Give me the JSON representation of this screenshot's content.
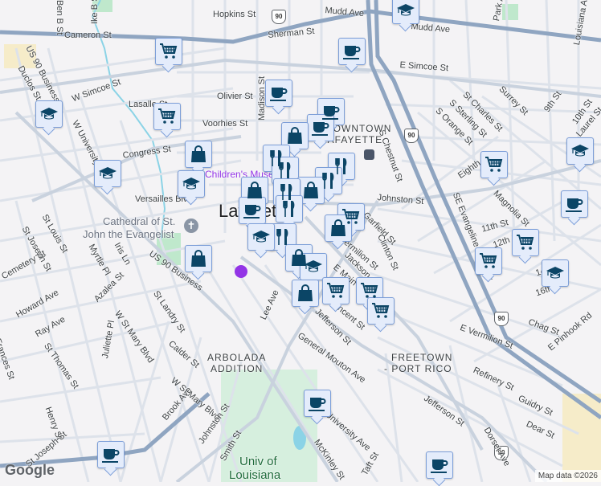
{
  "map": {
    "attribution": "Map data ©2026",
    "logo": "Google",
    "streets": [
      "Hopkins St",
      "Mudd Ave",
      "Cameron St",
      "Sherman St",
      "E Simcoe St",
      "W Simcoe St",
      "Olivier St",
      "Lasalle St",
      "Voorhies St",
      "Congress St",
      "Versailles Blvd",
      "Johnston St",
      "Garfield St",
      "Jefferson St",
      "General Mouton Ave",
      "University Ave",
      "Lee Ave",
      "Calder St",
      "W St Mary Blvd",
      "Brook Ave",
      "Smith St",
      "McKinley St",
      "Taft St",
      "St Landry St",
      "Azalea St",
      "Juliette Pl",
      "Howard Ave",
      "Ray Ave",
      "St Thomas St",
      "Henry St",
      "Myrtle Pl",
      "Iris Ln",
      "W St Mary Blvd",
      "St Joseph St",
      "St Louis St",
      "Duclos St",
      "US 90 Business",
      "W University Ave",
      "S Chestnut St",
      "S Orange St",
      "S Sterling St",
      "St Charles St",
      "Surrey St",
      "9th St",
      "10th St",
      "Eighth St",
      "Magnolia St",
      "11th St",
      "12th St",
      "14th St",
      "16th St",
      "Chag St",
      "E Pinhook Rd",
      "Refinery St",
      "Guidry St",
      "Dear St",
      "Dorset Ave",
      "E Vermilion St",
      "Jackson St",
      "Louisiana Ave",
      "SE Evangeline Thruway",
      "Park Ave",
      "Laurel St",
      "Ben B St",
      "Ike B St",
      "Madison St",
      "Clinton St",
      "E Main St",
      "Vincent St",
      "Jefferson St",
      "Frances St",
      "Cemetery St",
      "Lee Ave"
    ],
    "areas": [
      "DOWNTOWN",
      "LAFAYETTE",
      "ARBOLADA",
      "ADDITION",
      "FREETOWN",
      "- PORT RICO",
      "Univ of",
      "Louisiana"
    ],
    "pois": [
      "Cathedral of St.",
      "John the Evangelist",
      "Children's Museum"
    ],
    "city_label": "Lafayette",
    "route_shield": "90",
    "icon_types": [
      "shopping-cart",
      "coffee-cup",
      "shopping-bag",
      "restaurant",
      "graduation-cap"
    ],
    "colors": {
      "marker_bg": "#e4ecfb",
      "marker_border": "#7c9ed8",
      "icon": "#0b4566",
      "highway": "#8fa5c1",
      "road": "#dde2ea",
      "water": "#8bd3e6",
      "park": "#bfe8cc"
    }
  }
}
